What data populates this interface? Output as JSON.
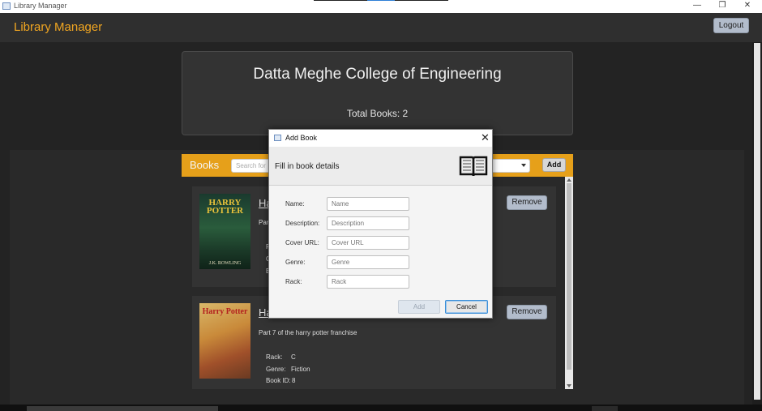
{
  "window": {
    "title": "Library Manager",
    "controls": {
      "minimize": "—",
      "maximize": "❐",
      "close": "✕"
    }
  },
  "appbar": {
    "title": "Library Manager",
    "logout_label": "Logout"
  },
  "header": {
    "college": "Datta Meghe College of Engineering",
    "total_books": "Total Books: 2"
  },
  "books_bar": {
    "label": "Books",
    "search_placeholder": "Search for",
    "add_label": "Add"
  },
  "books": [
    {
      "title": "Ha",
      "description": "Par",
      "meta_partial": [
        "R",
        "G",
        "B"
      ],
      "remove_label": "Remove",
      "cover_title": "HARRY POTTER",
      "cover_author": "J.K. ROWLING"
    },
    {
      "title": "Ha",
      "description": "Part 7 of the harry potter franchise",
      "rack_label": "Rack:",
      "rack": "C",
      "genre_label": "Genre:",
      "genre": "Fiction",
      "id_label": "Book ID:",
      "id": "8",
      "remove_label": "Remove",
      "cover_title": "Harry Potter",
      "cover_author": ""
    }
  ],
  "dialog": {
    "title": "Add Book",
    "close": "✕",
    "header_text": "Fill in book details",
    "fields": [
      {
        "label": "Name:",
        "placeholder": "Name"
      },
      {
        "label": "Description:",
        "placeholder": "Description"
      },
      {
        "label": "Cover URL:",
        "placeholder": "Cover URL"
      },
      {
        "label": "Genre:",
        "placeholder": "Genre"
      },
      {
        "label": "Rack:",
        "placeholder": "Rack"
      }
    ],
    "add_label": "Add",
    "cancel_label": "Cancel"
  },
  "colors": {
    "accent": "#f1a621",
    "books_bar": "#e6a01a",
    "button": "#b2bccb"
  }
}
